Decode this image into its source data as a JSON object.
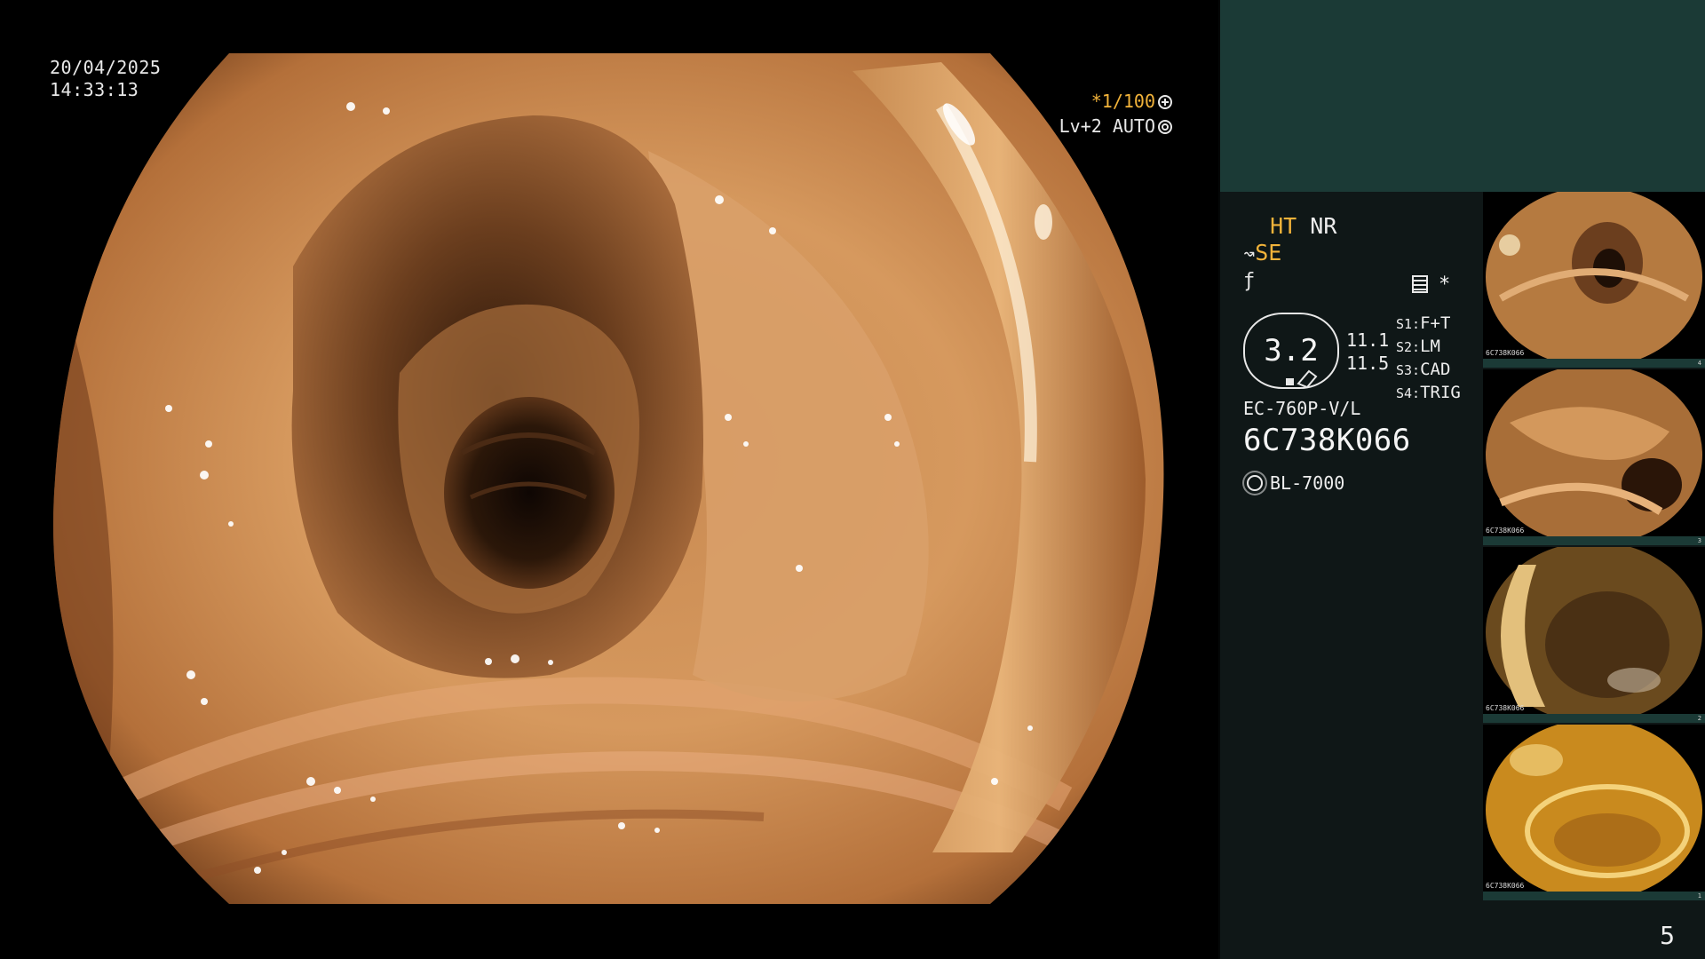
{
  "overlay": {
    "date": "20/04/2025",
    "time": "14:33:13",
    "shutter": "*1/100",
    "level": "Lv+2 AUTO",
    "icons": {
      "shutter": "fan-icon",
      "iris": "ring-icon"
    }
  },
  "info": {
    "ht": "HT",
    "nr": "NR",
    "se": "SE",
    "se_icon": "tilde-icon",
    "f_icon": "f-hook-icon",
    "memo_icon": "memo-icon",
    "asterisk": "*",
    "gauge_value": "3.2",
    "values": [
      "11.1",
      "11.5"
    ],
    "modes": [
      {
        "key": "S1:",
        "value": "F+T"
      },
      {
        "key": "S2:",
        "value": "LM"
      },
      {
        "key": "S3:",
        "value": "CAD"
      },
      {
        "key": "S4:",
        "value": "TRIG"
      }
    ],
    "model": "EC-760P-V/L",
    "serial": "6C738K066",
    "lamp_icon": "sun-icon",
    "lamp": "BL-7000"
  },
  "thumbnails": [
    {
      "id": "6C738K066",
      "num": "4"
    },
    {
      "id": "6C738K066",
      "num": "3"
    },
    {
      "id": "6C738K066",
      "num": "2"
    },
    {
      "id": "6C738K066",
      "num": "1"
    }
  ],
  "page_number": "5",
  "colors": {
    "accent": "#f2b33a",
    "panel": "#0f1717",
    "panel_top": "#1b3a36"
  }
}
